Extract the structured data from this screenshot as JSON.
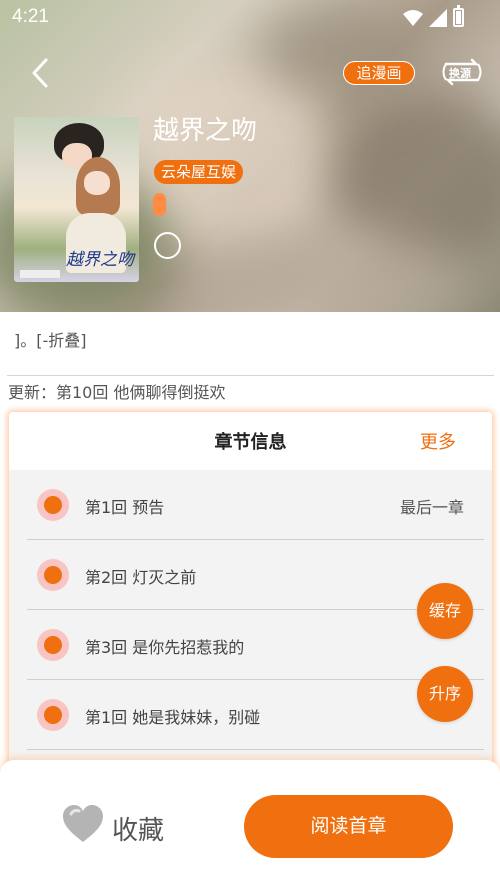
{
  "status_bar": {
    "time": "4:21"
  },
  "header": {
    "follow_label": "追漫画",
    "switch_label": "换源",
    "title": "越界之吻",
    "tag": "云朵屋互娱",
    "cover_title": "越界之吻"
  },
  "info": {
    "description": "]。[-折叠]",
    "update": "更新：第10回 他俩聊得倒挺欢"
  },
  "chapters": {
    "title": "章节信息",
    "more_label": "更多",
    "items": [
      {
        "name": "第1回 预告",
        "note": "最后一章"
      },
      {
        "name": "第2回 灯灭之前"
      },
      {
        "name": "第3回 是你先招惹我的"
      },
      {
        "name": "第1回 她是我妹妹，别碰"
      }
    ]
  },
  "fabs": {
    "cache": "缓存",
    "sort": "升序"
  },
  "bottom": {
    "favorite": "收藏",
    "read": "阅读首章"
  },
  "colors": {
    "accent": "#f07010",
    "dot_bg": "#f9c4c4"
  }
}
